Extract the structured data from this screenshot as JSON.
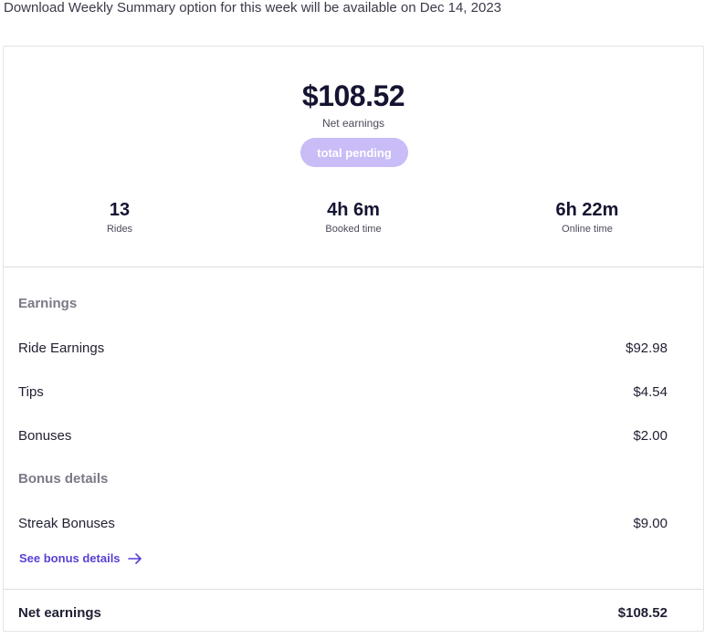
{
  "notice": "Download Weekly Summary option for this week will be available on Dec 14, 2023",
  "summary": {
    "net_amount": "$108.52",
    "net_label": "Net earnings",
    "pending_label": "total pending",
    "stats": [
      {
        "value": "13",
        "label": "Rides"
      },
      {
        "value": "4h 6m",
        "label": "Booked time"
      },
      {
        "value": "6h 22m",
        "label": "Online time"
      }
    ]
  },
  "earnings": {
    "heading": "Earnings",
    "items": [
      {
        "label": "Ride Earnings",
        "amount": "$92.98"
      },
      {
        "label": "Tips",
        "amount": "$4.54"
      },
      {
        "label": "Bonuses",
        "amount": "$2.00"
      }
    ]
  },
  "bonus_details": {
    "heading": "Bonus details",
    "items": [
      {
        "label": "Streak Bonuses",
        "amount": "$9.00"
      }
    ],
    "link_label": "See bonus details",
    "link_icon": "arrow-right-icon"
  },
  "footer": {
    "label": "Net earnings",
    "amount": "$108.52"
  },
  "colors": {
    "accent": "#5a3fd6",
    "pill": "#c9bcf7"
  }
}
